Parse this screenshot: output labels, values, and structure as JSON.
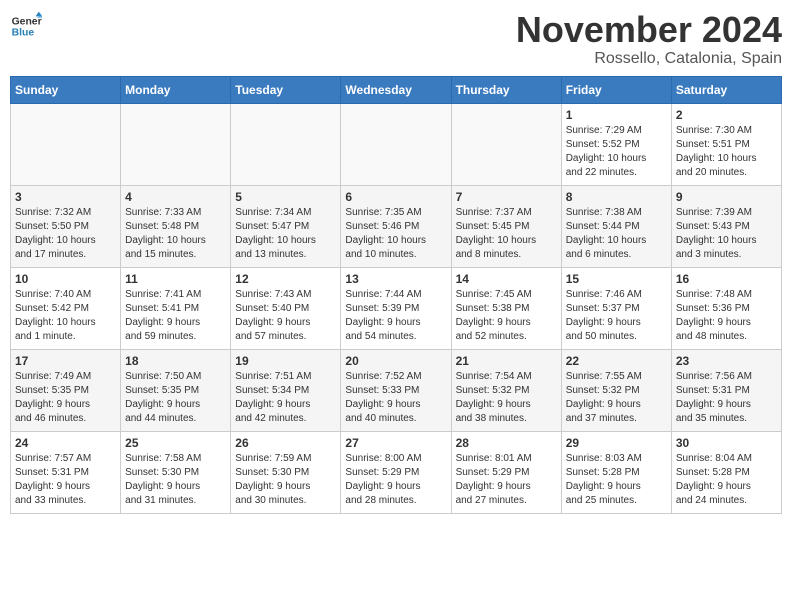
{
  "header": {
    "logo_general": "General",
    "logo_blue": "Blue",
    "month": "November 2024",
    "location": "Rossello, Catalonia, Spain"
  },
  "weekdays": [
    "Sunday",
    "Monday",
    "Tuesday",
    "Wednesday",
    "Thursday",
    "Friday",
    "Saturday"
  ],
  "weeks": [
    [
      {
        "day": "",
        "info": ""
      },
      {
        "day": "",
        "info": ""
      },
      {
        "day": "",
        "info": ""
      },
      {
        "day": "",
        "info": ""
      },
      {
        "day": "",
        "info": ""
      },
      {
        "day": "1",
        "info": "Sunrise: 7:29 AM\nSunset: 5:52 PM\nDaylight: 10 hours\nand 22 minutes."
      },
      {
        "day": "2",
        "info": "Sunrise: 7:30 AM\nSunset: 5:51 PM\nDaylight: 10 hours\nand 20 minutes."
      }
    ],
    [
      {
        "day": "3",
        "info": "Sunrise: 7:32 AM\nSunset: 5:50 PM\nDaylight: 10 hours\nand 17 minutes."
      },
      {
        "day": "4",
        "info": "Sunrise: 7:33 AM\nSunset: 5:48 PM\nDaylight: 10 hours\nand 15 minutes."
      },
      {
        "day": "5",
        "info": "Sunrise: 7:34 AM\nSunset: 5:47 PM\nDaylight: 10 hours\nand 13 minutes."
      },
      {
        "day": "6",
        "info": "Sunrise: 7:35 AM\nSunset: 5:46 PM\nDaylight: 10 hours\nand 10 minutes."
      },
      {
        "day": "7",
        "info": "Sunrise: 7:37 AM\nSunset: 5:45 PM\nDaylight: 10 hours\nand 8 minutes."
      },
      {
        "day": "8",
        "info": "Sunrise: 7:38 AM\nSunset: 5:44 PM\nDaylight: 10 hours\nand 6 minutes."
      },
      {
        "day": "9",
        "info": "Sunrise: 7:39 AM\nSunset: 5:43 PM\nDaylight: 10 hours\nand 3 minutes."
      }
    ],
    [
      {
        "day": "10",
        "info": "Sunrise: 7:40 AM\nSunset: 5:42 PM\nDaylight: 10 hours\nand 1 minute."
      },
      {
        "day": "11",
        "info": "Sunrise: 7:41 AM\nSunset: 5:41 PM\nDaylight: 9 hours\nand 59 minutes."
      },
      {
        "day": "12",
        "info": "Sunrise: 7:43 AM\nSunset: 5:40 PM\nDaylight: 9 hours\nand 57 minutes."
      },
      {
        "day": "13",
        "info": "Sunrise: 7:44 AM\nSunset: 5:39 PM\nDaylight: 9 hours\nand 54 minutes."
      },
      {
        "day": "14",
        "info": "Sunrise: 7:45 AM\nSunset: 5:38 PM\nDaylight: 9 hours\nand 52 minutes."
      },
      {
        "day": "15",
        "info": "Sunrise: 7:46 AM\nSunset: 5:37 PM\nDaylight: 9 hours\nand 50 minutes."
      },
      {
        "day": "16",
        "info": "Sunrise: 7:48 AM\nSunset: 5:36 PM\nDaylight: 9 hours\nand 48 minutes."
      }
    ],
    [
      {
        "day": "17",
        "info": "Sunrise: 7:49 AM\nSunset: 5:35 PM\nDaylight: 9 hours\nand 46 minutes."
      },
      {
        "day": "18",
        "info": "Sunrise: 7:50 AM\nSunset: 5:35 PM\nDaylight: 9 hours\nand 44 minutes."
      },
      {
        "day": "19",
        "info": "Sunrise: 7:51 AM\nSunset: 5:34 PM\nDaylight: 9 hours\nand 42 minutes."
      },
      {
        "day": "20",
        "info": "Sunrise: 7:52 AM\nSunset: 5:33 PM\nDaylight: 9 hours\nand 40 minutes."
      },
      {
        "day": "21",
        "info": "Sunrise: 7:54 AM\nSunset: 5:32 PM\nDaylight: 9 hours\nand 38 minutes."
      },
      {
        "day": "22",
        "info": "Sunrise: 7:55 AM\nSunset: 5:32 PM\nDaylight: 9 hours\nand 37 minutes."
      },
      {
        "day": "23",
        "info": "Sunrise: 7:56 AM\nSunset: 5:31 PM\nDaylight: 9 hours\nand 35 minutes."
      }
    ],
    [
      {
        "day": "24",
        "info": "Sunrise: 7:57 AM\nSunset: 5:31 PM\nDaylight: 9 hours\nand 33 minutes."
      },
      {
        "day": "25",
        "info": "Sunrise: 7:58 AM\nSunset: 5:30 PM\nDaylight: 9 hours\nand 31 minutes."
      },
      {
        "day": "26",
        "info": "Sunrise: 7:59 AM\nSunset: 5:30 PM\nDaylight: 9 hours\nand 30 minutes."
      },
      {
        "day": "27",
        "info": "Sunrise: 8:00 AM\nSunset: 5:29 PM\nDaylight: 9 hours\nand 28 minutes."
      },
      {
        "day": "28",
        "info": "Sunrise: 8:01 AM\nSunset: 5:29 PM\nDaylight: 9 hours\nand 27 minutes."
      },
      {
        "day": "29",
        "info": "Sunrise: 8:03 AM\nSunset: 5:28 PM\nDaylight: 9 hours\nand 25 minutes."
      },
      {
        "day": "30",
        "info": "Sunrise: 8:04 AM\nSunset: 5:28 PM\nDaylight: 9 hours\nand 24 minutes."
      }
    ]
  ]
}
